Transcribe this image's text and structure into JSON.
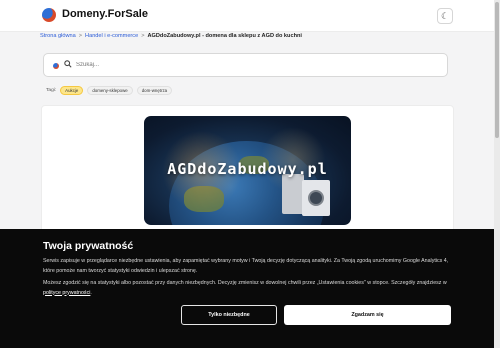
{
  "header": {
    "brand": "Domeny.ForSale",
    "logo_icon": "globe-logo",
    "theme_toggle_icon": "moon-icon",
    "theme_toggle_glyph": "☾"
  },
  "breadcrumb": {
    "items": [
      "Strona główna",
      "Handel i e-commerce",
      "AGDdoZabudowy.pl - domena dla sklepu z AGD do kuchni"
    ],
    "separator": ">"
  },
  "search": {
    "placeholder": "Szukaj...",
    "value": "",
    "icon": "search-icon",
    "flag_icon": "language-flag-icon"
  },
  "tags": {
    "label": "Tagi:",
    "items": [
      "Aukcje",
      "domeny-sklepowe",
      "dom-wnętrza"
    ],
    "highlight_color": "#fde68a"
  },
  "hero": {
    "text": "AGDdoZabudowy.pl"
  },
  "cookie": {
    "title": "Twoja prywatność",
    "paragraph1": "Serwis zapisuje w przeglądarce niezbędne ustawienia, aby zapamiętać wybrany motyw i Twoją decyzję dotyczącą analityki. Za Twoją zgodą uruchomimy Google Analytics 4, które pomoże nam tworzyć statystyki odwiedzin i ulepszać stronę.",
    "paragraph2_before": "Możesz zgodzić się na statystyki albo pozostać przy danych niezbędnych. Decyzję zmienisz w dowolnej chwili przez „Ustawienia cookies\" w stopce. Szczegóły znajdziesz w ",
    "policy_link": "polityce prywatności",
    "paragraph2_after": ".",
    "btn_necessary": "Tylko niezbędne",
    "btn_accept": "Zgadzam się",
    "background": "#0a0a0a"
  },
  "colors": {
    "link": "#2a5bd7",
    "page_bg": "#f4f4f5"
  }
}
